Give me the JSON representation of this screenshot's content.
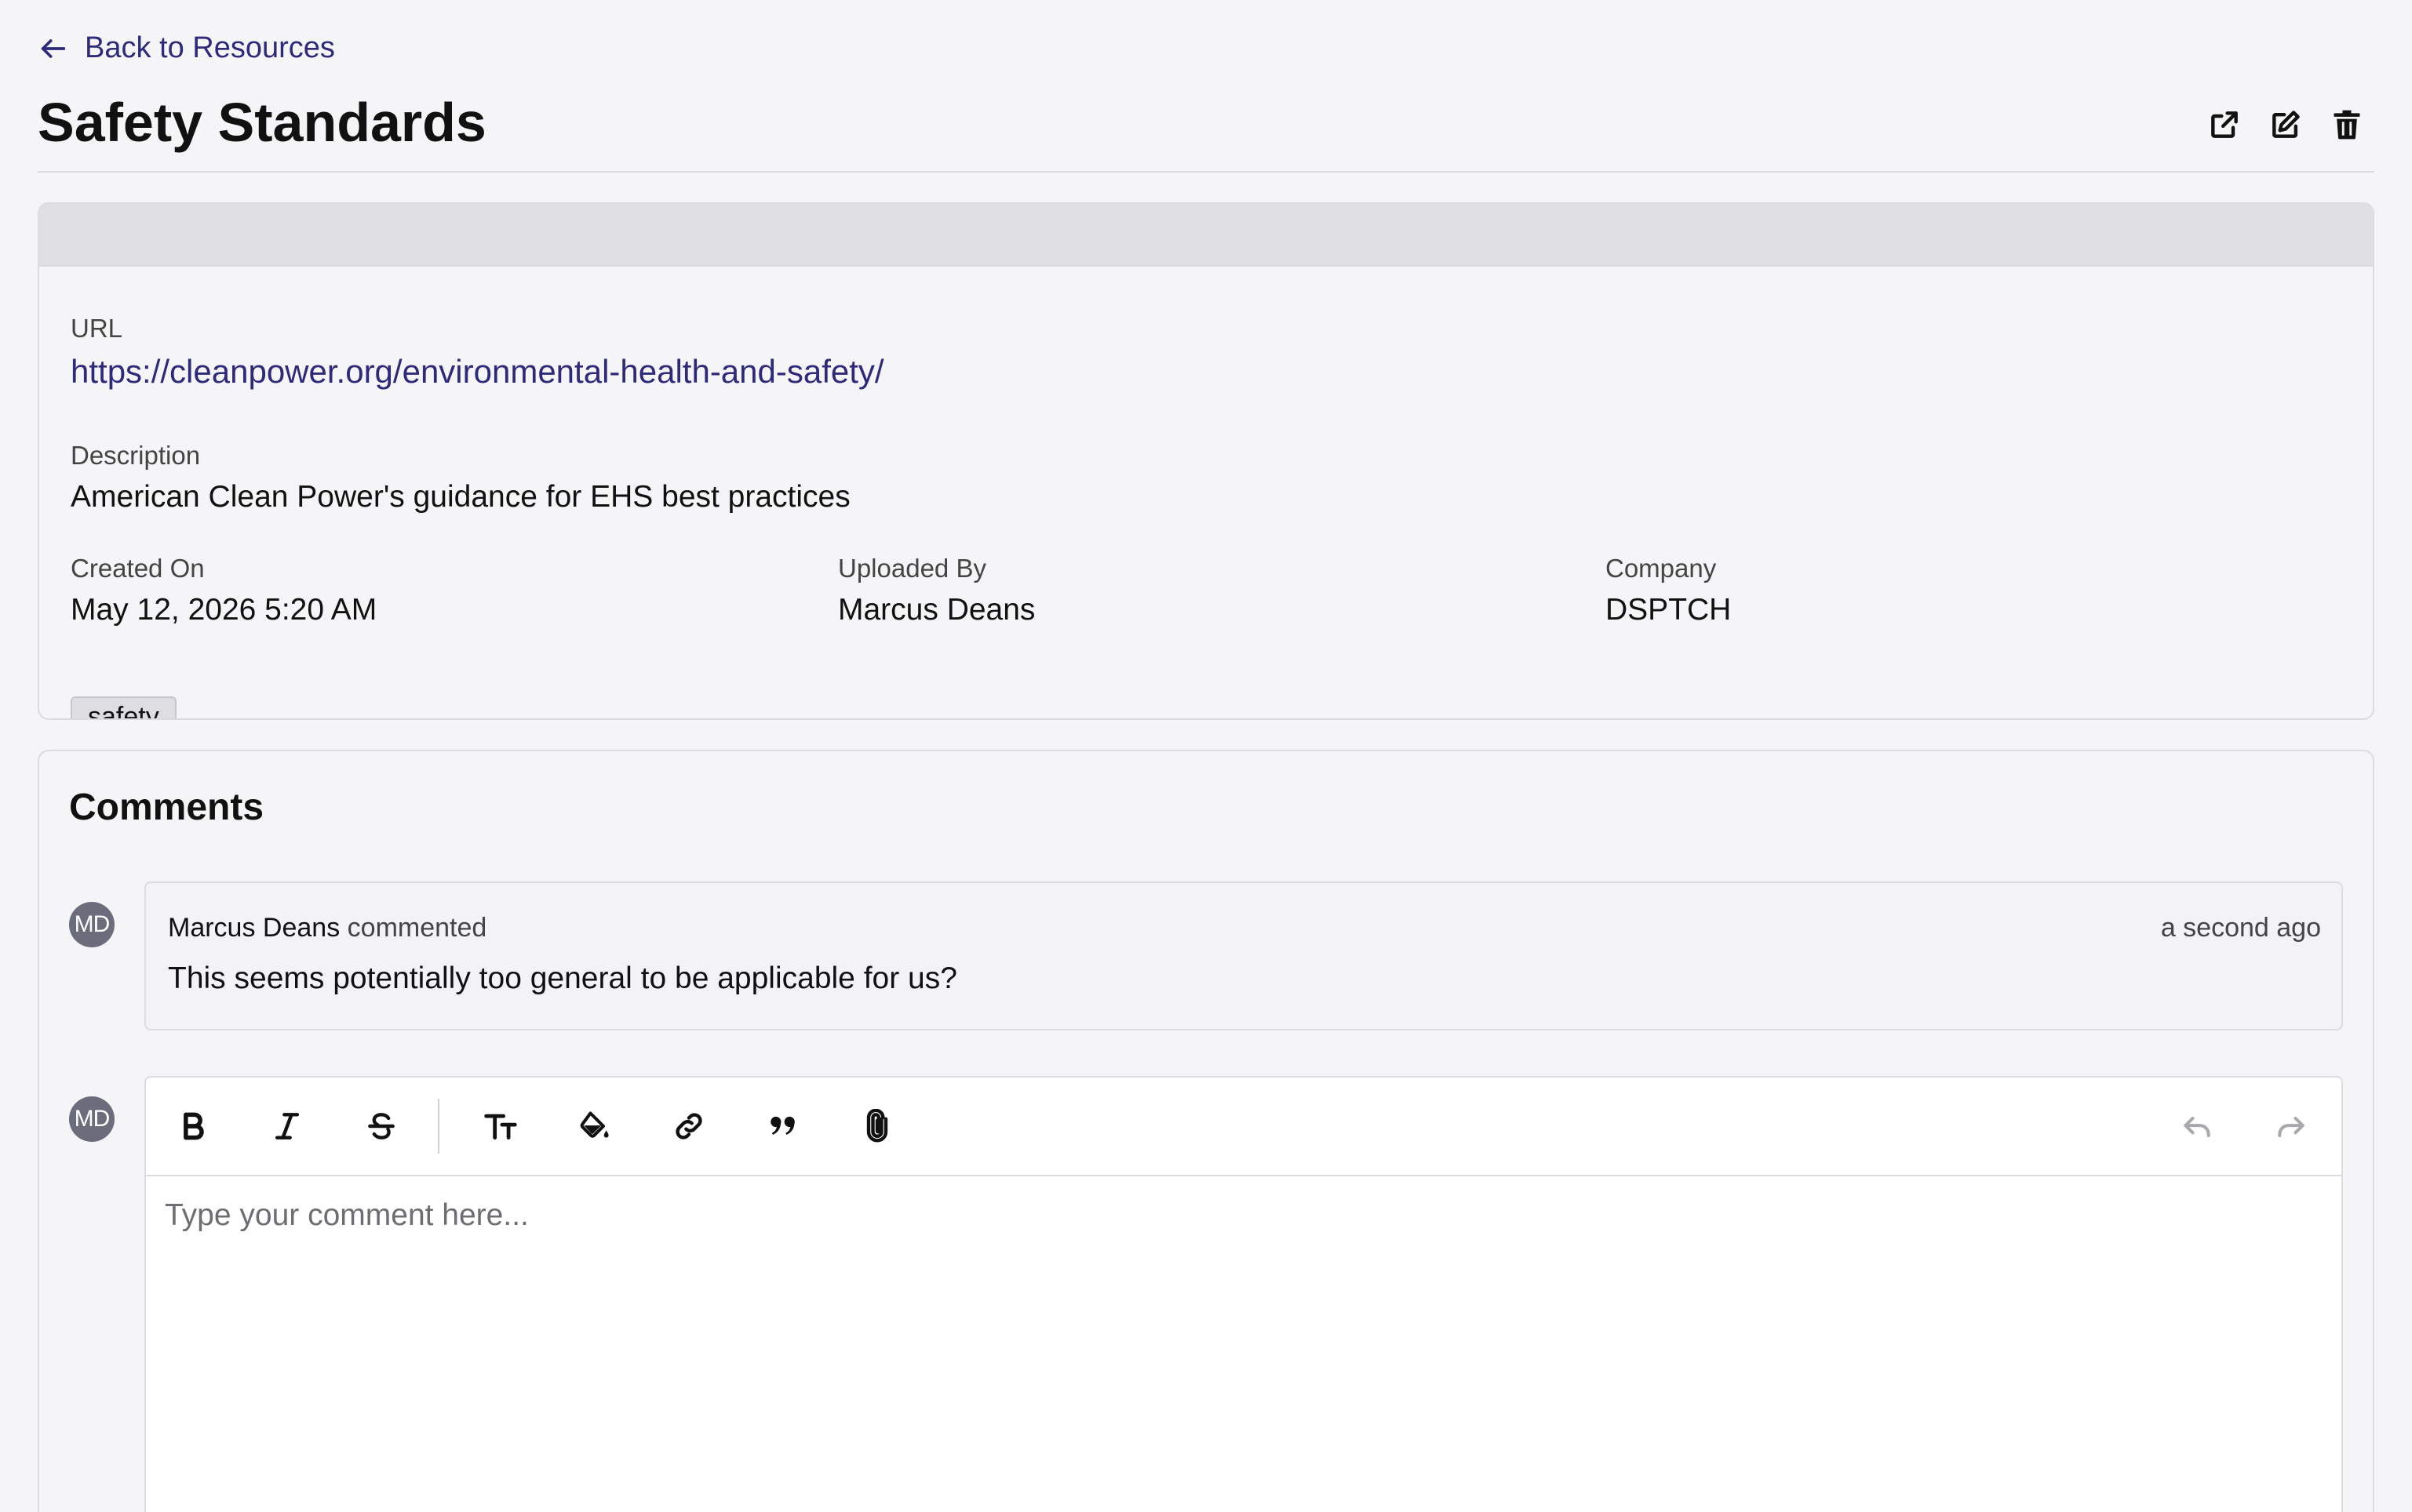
{
  "nav": {
    "back_label": "Back to Resources"
  },
  "resource": {
    "title": "Safety Standards",
    "url_label": "URL",
    "url": "https://cleanpower.org/environmental-health-and-safety/",
    "description_label": "Description",
    "description": "American Clean Power's guidance for EHS best practices",
    "created_label": "Created On",
    "created": "May 12, 2026 5:20 AM",
    "uploaded_label": "Uploaded By",
    "uploaded_by": "Marcus Deans",
    "company_label": "Company",
    "company": "DSPTCH",
    "tags": [
      "safety"
    ]
  },
  "comments": {
    "title": "Comments",
    "items": [
      {
        "avatar": "MD",
        "author": "Marcus Deans",
        "action": "commented",
        "time": "a second ago",
        "text": "This seems potentially too general to be applicable for us?"
      }
    ],
    "composer": {
      "avatar": "MD",
      "placeholder": "Type your comment here..."
    }
  },
  "icons": {
    "back": "arrow-left-icon",
    "open": "external-link-icon",
    "edit": "edit-icon",
    "delete": "trash-icon",
    "toolbar": [
      "bold-icon",
      "italic-icon",
      "strikethrough-icon",
      "text-size-icon",
      "fill-color-icon",
      "link-icon",
      "quote-icon",
      "attachment-icon",
      "undo-icon",
      "redo-icon"
    ]
  },
  "colors": {
    "accent": "#2d2a7a",
    "background": "#f5f4f7",
    "avatar": "#6c6d7c"
  }
}
